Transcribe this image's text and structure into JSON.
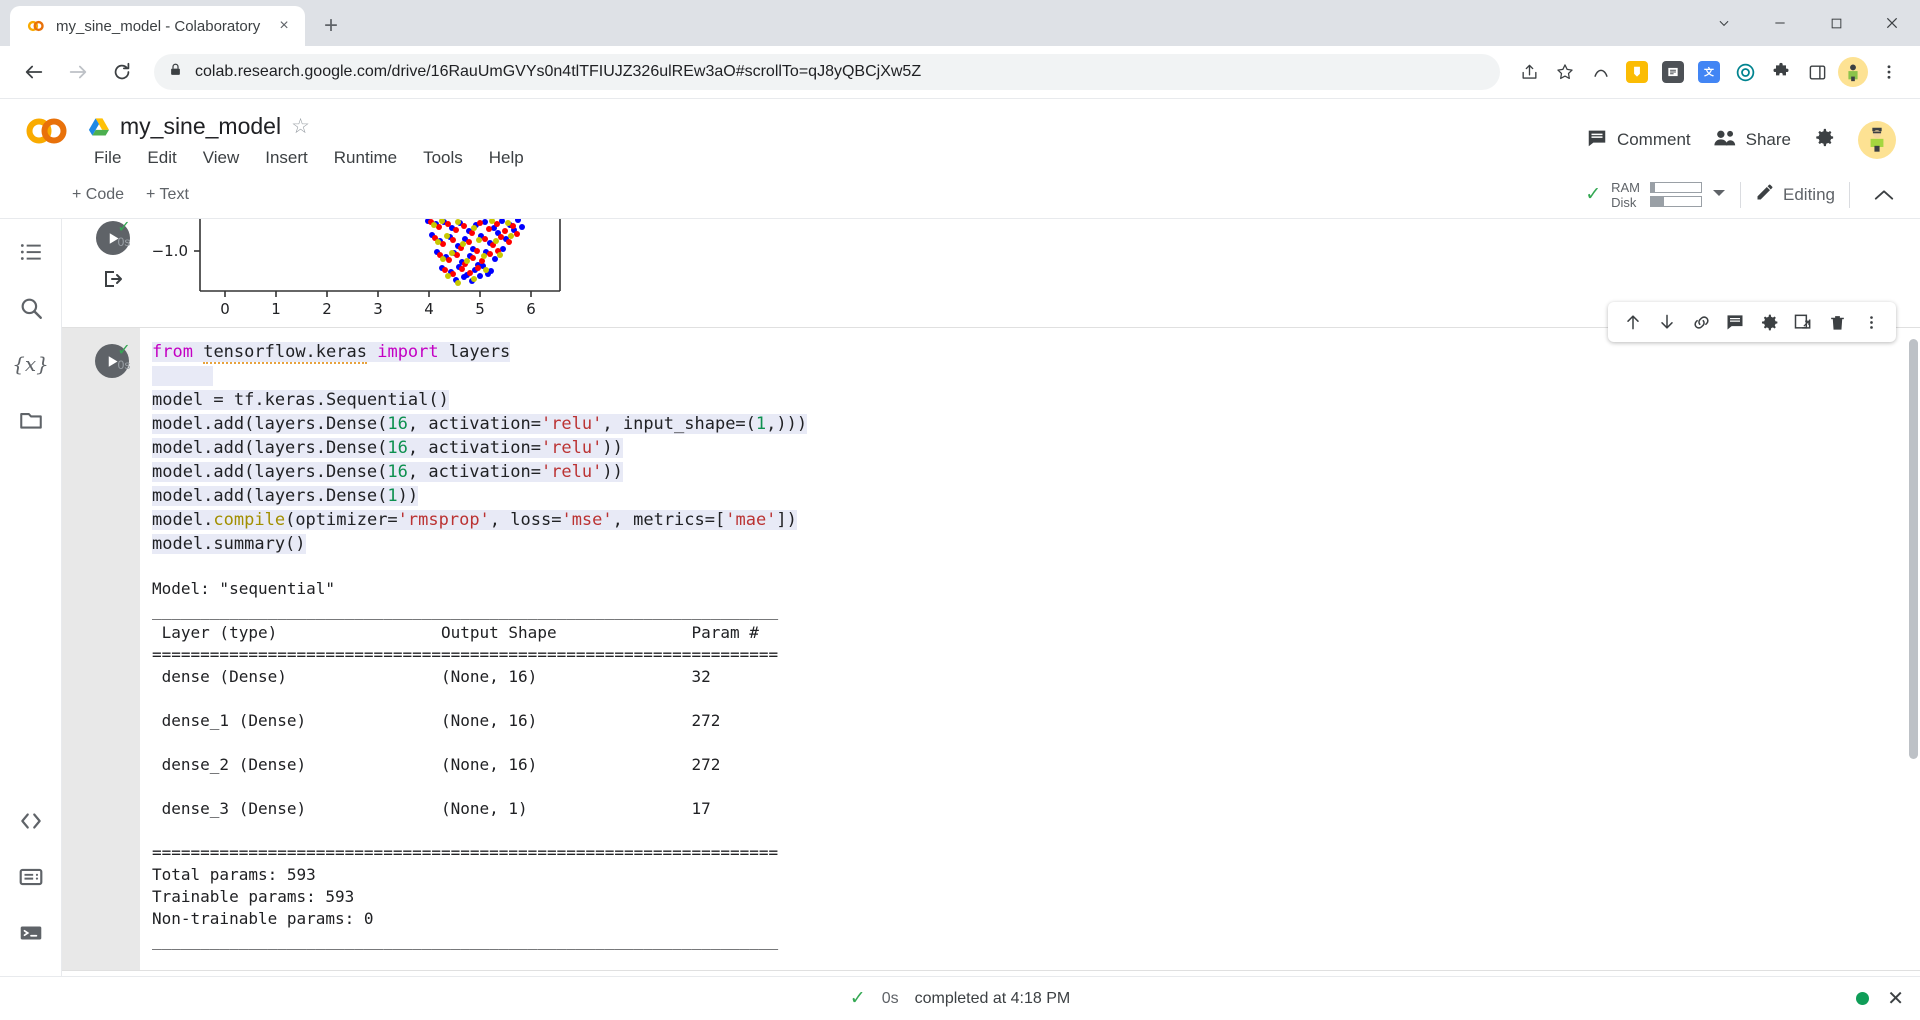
{
  "browser": {
    "tab": {
      "title": "my_sine_model - Colaboratory",
      "favicon": "colab-icon",
      "close": "×"
    },
    "newtab_label": "+",
    "window_controls": {
      "minimize": "—",
      "maximize": "□",
      "close": "✕",
      "chevron": "⌄"
    },
    "nav": {
      "back": "←",
      "forward": "→",
      "reload": "⟳",
      "lock": "lock-icon"
    },
    "url": {
      "host": "colab.research.google.com",
      "path": "/drive/16RauUmGVYs0n4tlTFIUJZ326ulREw3aO#scrollTo=qJ8yQBCjXw5Z",
      "full": "colab.research.google.com/drive/16RauUmGVYs0n4tlTFIUJZ326ulREw3aO#scrollTo=qJ8yQBCjXw5Z"
    },
    "omnibox_actions": [
      "share-icon",
      "bookmark-star-icon",
      "extension-icon"
    ],
    "extensions": [
      {
        "name": "keep-extension",
        "glyph": "",
        "color": "#fbbc04"
      },
      {
        "name": "dictionary-extension",
        "glyph": "",
        "color": "#4285f4"
      },
      {
        "name": "translate-extension",
        "glyph": "",
        "color": "#4285f4"
      },
      {
        "name": "circle-extension",
        "glyph": "",
        "color": "#00838f"
      }
    ],
    "profile_avatar": "user-avatar"
  },
  "colab": {
    "logo": "CO",
    "doc_title": "my_sine_model",
    "star": "☆",
    "menus": [
      "File",
      "Edit",
      "View",
      "Insert",
      "Runtime",
      "Tools",
      "Help"
    ],
    "header_actions": [
      {
        "name": "comment",
        "label": "Comment",
        "icon": "comment-icon"
      },
      {
        "name": "share",
        "label": "Share",
        "icon": "people-icon"
      }
    ],
    "settings_icon": "gear-icon",
    "account_avatar": "account-avatar",
    "toolbar": {
      "add_code": "+ Code",
      "add_text": "+ Text",
      "ram_label": "RAM",
      "disk_label": "Disk",
      "ram_fill_pct": 8,
      "disk_fill_pct": 25,
      "connected_check": "✓",
      "editing_label": "Editing",
      "pencil_icon": "pencil-icon",
      "caret": "▾",
      "collapse_icon": "chevron-up-icon"
    },
    "left_rail": [
      {
        "name": "table-of-contents",
        "icon": "list-icon"
      },
      {
        "name": "find-and-replace",
        "icon": "search-icon"
      },
      {
        "name": "variables",
        "icon": "variables-icon",
        "glyph": "{x}"
      },
      {
        "name": "files",
        "icon": "folder-icon"
      }
    ],
    "left_rail_bottom": [
      {
        "name": "code-snippets",
        "icon": "code-brackets-icon",
        "glyph": "<>"
      },
      {
        "name": "command-palette",
        "icon": "command-palette-icon"
      },
      {
        "name": "terminal",
        "icon": "terminal-icon",
        "glyph": ">_"
      }
    ],
    "cell_toolbar": [
      {
        "name": "move-cell-up",
        "icon": "arrow-up-icon"
      },
      {
        "name": "move-cell-down",
        "icon": "arrow-down-icon"
      },
      {
        "name": "link-to-cell",
        "icon": "link-icon"
      },
      {
        "name": "add-comment",
        "icon": "comment-icon"
      },
      {
        "name": "cell-settings",
        "icon": "gear-icon"
      },
      {
        "name": "mirror-cell",
        "icon": "open-in-new-icon"
      },
      {
        "name": "delete-cell",
        "icon": "trash-icon"
      },
      {
        "name": "more-options",
        "icon": "more-vert-icon"
      }
    ],
    "cells": [
      {
        "name": "plot-cell",
        "status_check": "✓",
        "exec_time": "0s",
        "run_icon": "play-icon",
        "output_icon": "output-arrow-icon"
      },
      {
        "name": "model-cell",
        "status_check": "✓",
        "exec_time": "0s",
        "run_icon": "play-icon",
        "code_lines": [
          "from tensorflow.keras import layers",
          "",
          "model = tf.keras.Sequential()",
          "model.add(layers.Dense(16, activation='relu', input_shape=(1,)))",
          "model.add(layers.Dense(16, activation='relu'))",
          "model.add(layers.Dense(16, activation='relu'))",
          "model.add(layers.Dense(1))",
          "model.compile(optimizer='rmsprop', loss='mse', metrics=['mae'])",
          "model.summary()"
        ],
        "output": {
          "model_name": "Model: \"sequential\"",
          "rule_dash": "_________________________________________________________________",
          "rule_eq": "=================================================================",
          "headers": [
            "Layer (type)",
            "Output Shape",
            "Param #"
          ],
          "rows": [
            {
              "layer": "dense (Dense)",
              "shape": "(None, 16)",
              "params": "32"
            },
            {
              "layer": "dense_1 (Dense)",
              "shape": "(None, 16)",
              "params": "272"
            },
            {
              "layer": "dense_2 (Dense)",
              "shape": "(None, 16)",
              "params": "272"
            },
            {
              "layer": "dense_3 (Dense)",
              "shape": "(None, 1)",
              "params": "17"
            }
          ],
          "totals": [
            "Total params: 593",
            "Trainable params: 593",
            "Non-trainable params: 0"
          ]
        }
      }
    ],
    "statusbar": {
      "check": "✓",
      "time": "0s",
      "message": "completed at 4:18 PM",
      "indicator": "connected-dot",
      "close": "✕"
    }
  },
  "chart_data": {
    "type": "scatter",
    "title": "",
    "xlabel": "",
    "ylabel": "",
    "xticks": [
      "0",
      "1",
      "2",
      "3",
      "4",
      "5",
      "6"
    ],
    "yticks": [
      "-1.0"
    ],
    "xlim": [
      -0.5,
      6.6
    ],
    "ylim": [
      -1.35,
      -0.55
    ],
    "grid": false,
    "note": "Bottom portion of a sine-wave scatter plot; three overlapping series of points clustered between x=3.8 and x=5.7 near y=-1.0",
    "series": [
      {
        "name": "series-blue",
        "color": "#0000ff"
      },
      {
        "name": "series-red",
        "color": "#ff0000"
      },
      {
        "name": "series-yellow",
        "color": "#c8c800"
      }
    ]
  }
}
